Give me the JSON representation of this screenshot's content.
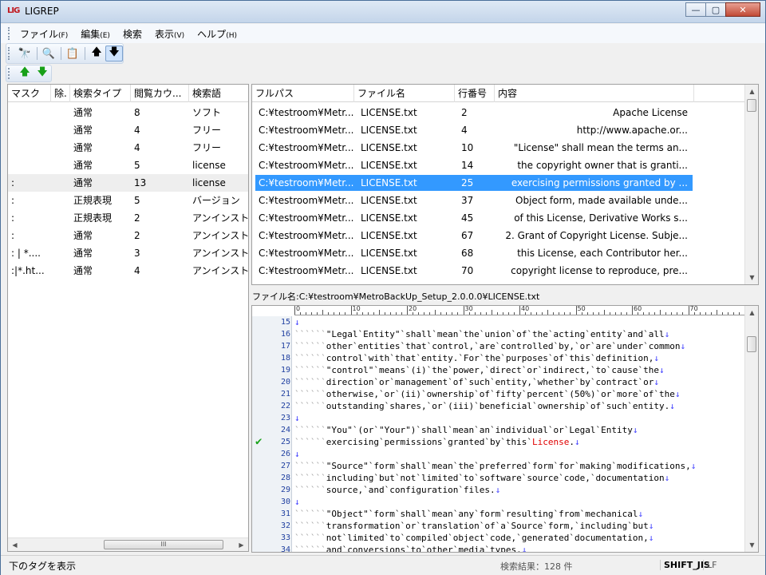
{
  "window": {
    "logo": "LIG",
    "title": "LIGREP",
    "minimize": "—",
    "maximize": "▢",
    "close": "✕"
  },
  "menu": [
    {
      "label": "ファイル",
      "key": "(F)"
    },
    {
      "label": "編集",
      "key": "(E)"
    },
    {
      "label": "検索",
      "key": ""
    },
    {
      "label": "表示",
      "key": "(V)"
    },
    {
      "label": "ヘルプ",
      "key": "(H)"
    }
  ],
  "toolbar": {
    "icons": [
      "binoculars-icon",
      "preview-icon",
      "properties-icon",
      "arrow-up-icon",
      "arrow-down-icon"
    ],
    "glyphs": [
      "🔭",
      "🔍",
      "📋",
      "🡅",
      "🡇"
    ],
    "row2_glyphs": [
      "🡅",
      "🡇"
    ]
  },
  "left_table": {
    "headers": [
      "マスク",
      "除.",
      "検索タイプ",
      "閲覧カウ...",
      "検索語"
    ],
    "rows": [
      {
        "mask": "",
        "type": "通常",
        "count": "8",
        "word": "ソフト"
      },
      {
        "mask": "",
        "type": "通常",
        "count": "4",
        "word": "フリー"
      },
      {
        "mask": "",
        "type": "通常",
        "count": "4",
        "word": "フリー"
      },
      {
        "mask": "",
        "type": "通常",
        "count": "5",
        "word": "license"
      },
      {
        "mask": ":",
        "type": "通常",
        "count": "13",
        "word": "license"
      },
      {
        "mask": ":",
        "type": "正規表現",
        "count": "5",
        "word": "バージョン"
      },
      {
        "mask": ":",
        "type": "正規表現",
        "count": "2",
        "word": "アンインスト"
      },
      {
        "mask": ":",
        "type": "通常",
        "count": "2",
        "word": "アンインスト"
      },
      {
        "mask": ": | *....",
        "type": "通常",
        "count": "3",
        "word": "アンインスト"
      },
      {
        "mask": ":|*.ht...",
        "type": "通常",
        "count": "4",
        "word": "アンインスト"
      }
    ],
    "hscroll_thumb": "III"
  },
  "results_table": {
    "headers": [
      "フルパス",
      "ファイル名",
      "行番号",
      "内容"
    ],
    "rows": [
      {
        "path": "C:¥testroom¥Metr...",
        "file": "LICENSE.txt",
        "line": "2",
        "content": "Apache License"
      },
      {
        "path": "C:¥testroom¥Metr...",
        "file": "LICENSE.txt",
        "line": "4",
        "content": "http://www.apache.or..."
      },
      {
        "path": "C:¥testroom¥Metr...",
        "file": "LICENSE.txt",
        "line": "10",
        "content": "\"License\" shall mean the terms an..."
      },
      {
        "path": "C:¥testroom¥Metr...",
        "file": "LICENSE.txt",
        "line": "14",
        "content": "the copyright owner that is granti..."
      },
      {
        "path": "C:¥testroom¥Metr...",
        "file": "LICENSE.txt",
        "line": "25",
        "content": "exercising permissions granted by ..."
      },
      {
        "path": "C:¥testroom¥Metr...",
        "file": "LICENSE.txt",
        "line": "37",
        "content": "Object form, made available unde..."
      },
      {
        "path": "C:¥testroom¥Metr...",
        "file": "LICENSE.txt",
        "line": "45",
        "content": "of this License, Derivative Works s..."
      },
      {
        "path": "C:¥testroom¥Metr...",
        "file": "LICENSE.txt",
        "line": "67",
        "content": "2. Grant of Copyright License. Subje..."
      },
      {
        "path": "C:¥testroom¥Metr...",
        "file": "LICENSE.txt",
        "line": "68",
        "content": "this License, each Contributor her..."
      },
      {
        "path": "C:¥testroom¥Metr...",
        "file": "LICENSE.txt",
        "line": "70",
        "content": "copyright license to reproduce, pre..."
      }
    ],
    "selected_index": 4
  },
  "file_label": "ファイル名:C:¥testroom¥MetroBackUp_Setup_2.0.0.0¥LICENSE.txt",
  "ruler": {
    "marks": [
      "0",
      "10",
      "20",
      "30",
      "40",
      "50",
      "60",
      "70"
    ]
  },
  "viewer": {
    "eol": "↓",
    "lines": [
      {
        "n": "15",
        "indent": 0,
        "text": ""
      },
      {
        "n": "16",
        "indent": 6,
        "text": "\"Legal Entity\" shall mean the union of the acting entity and all"
      },
      {
        "n": "17",
        "indent": 6,
        "text": "other entities that control, are controlled by, or are under common"
      },
      {
        "n": "18",
        "indent": 6,
        "text": "control with that entity. For the purposes of this definition,"
      },
      {
        "n": "19",
        "indent": 6,
        "text": "\"control\" means (i) the power, direct or indirect, to cause the"
      },
      {
        "n": "20",
        "indent": 6,
        "text": "direction or management of such entity, whether by contract or"
      },
      {
        "n": "21",
        "indent": 6,
        "text": "otherwise, or (ii) ownership of fifty percent (50%) or more of the"
      },
      {
        "n": "22",
        "indent": 6,
        "text": "outstanding shares, or (iii) beneficial ownership of such entity."
      },
      {
        "n": "23",
        "indent": 0,
        "text": ""
      },
      {
        "n": "24",
        "indent": 6,
        "text": "\"You\" (or \"Your\") shall mean an individual or Legal Entity"
      },
      {
        "n": "25",
        "indent": 6,
        "text": "exercising permissions granted by this ",
        "hl": "License",
        "tail": ".",
        "mark": "✔"
      },
      {
        "n": "26",
        "indent": 0,
        "text": ""
      },
      {
        "n": "27",
        "indent": 6,
        "text": "\"Source\" form shall mean the preferred form for making modifications,"
      },
      {
        "n": "28",
        "indent": 6,
        "text": "including but not limited to software source code, documentation"
      },
      {
        "n": "29",
        "indent": 6,
        "text": "source, and configuration files."
      },
      {
        "n": "30",
        "indent": 0,
        "text": ""
      },
      {
        "n": "31",
        "indent": 6,
        "text": "\"Object\" form shall mean any form resulting from mechanical"
      },
      {
        "n": "32",
        "indent": 6,
        "text": "transformation or translation of a Source form, including but"
      },
      {
        "n": "33",
        "indent": 6,
        "text": "not limited to compiled object code, generated documentation,"
      },
      {
        "n": "34",
        "indent": 6,
        "text": "and conversions to other media types."
      }
    ]
  },
  "status": {
    "left": "下のタグを表示",
    "count": "検索結果：128 件",
    "encoding": "SHIFT_JIS",
    "eol": "LF"
  }
}
